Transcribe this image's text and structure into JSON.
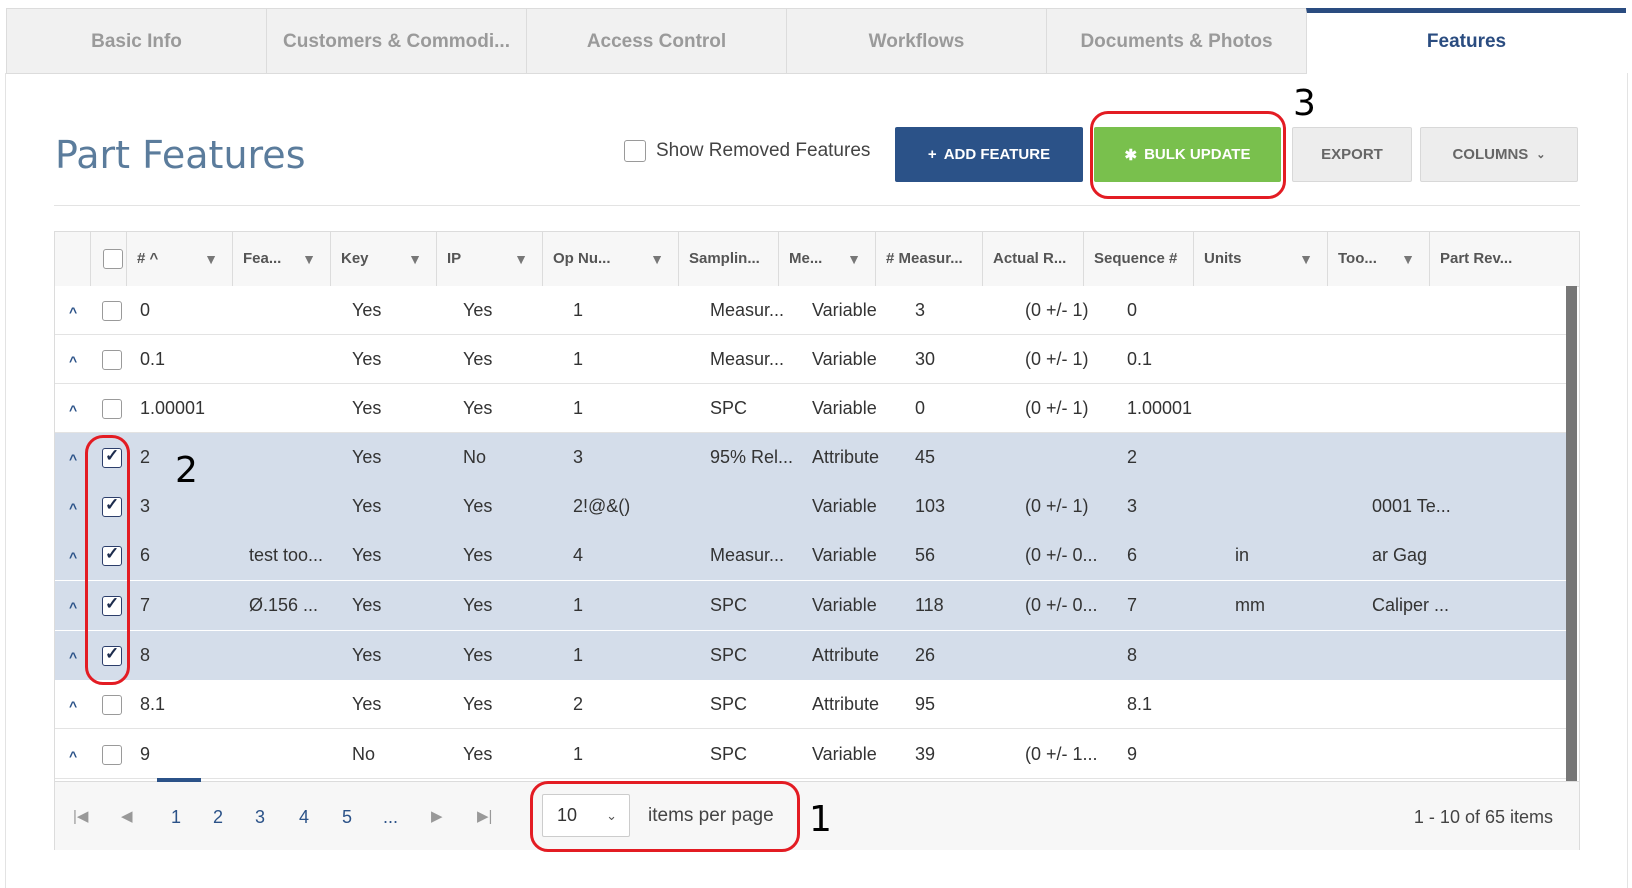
{
  "tabs": [
    {
      "label": "Basic Info",
      "active": false
    },
    {
      "label": "Customers & Commodi...",
      "active": false
    },
    {
      "label": "Access Control",
      "active": false
    },
    {
      "label": "Workflows",
      "active": false
    },
    {
      "label": "Documents & Photos",
      "active": false
    },
    {
      "label": "Features",
      "active": true
    }
  ],
  "header": {
    "title": "Part Features",
    "show_removed_label": "Show Removed Features",
    "add_feature_label": "ADD FEATURE",
    "bulk_update_label": "BULK UPDATE",
    "export_label": "EXPORT",
    "columns_label": "COLUMNS"
  },
  "grid": {
    "columns": [
      "#",
      "Fea...",
      "Key",
      "IP",
      "Op Nu...",
      "Samplin...",
      "Me...",
      "# Measur...",
      "Actual R...",
      "Sequence #",
      "Units",
      "Too...",
      "Part Rev..."
    ],
    "rows": [
      {
        "checked": false,
        "cells": [
          "0",
          "",
          "Yes",
          "Yes",
          "1",
          "Measur...",
          "Variable",
          "3",
          "(0 +/- 1)",
          "0",
          "",
          "",
          ""
        ]
      },
      {
        "checked": false,
        "cells": [
          "0.1",
          "",
          "Yes",
          "Yes",
          "1",
          "Measur...",
          "Variable",
          "30",
          "(0 +/- 1)",
          "0.1",
          "",
          "",
          ""
        ]
      },
      {
        "checked": false,
        "cells": [
          "1.00001",
          "",
          "Yes",
          "Yes",
          "1",
          "SPC",
          "Variable",
          "0",
          "(0 +/- 1)",
          "1.00001",
          "",
          "",
          ""
        ]
      },
      {
        "checked": true,
        "cells": [
          "2",
          "",
          "Yes",
          "No",
          "3",
          "95% Rel...",
          "Attribute",
          "45",
          "",
          "2",
          "",
          "",
          ""
        ]
      },
      {
        "checked": true,
        "cells": [
          "3",
          "",
          "Yes",
          "Yes",
          "2!@&()",
          "",
          "Variable",
          "103",
          "(0 +/- 1)",
          "3",
          "",
          "0001 Te...",
          ""
        ]
      },
      {
        "checked": true,
        "cells": [
          "6",
          "test too...",
          "Yes",
          "Yes",
          "4",
          "Measur...",
          "Variable",
          "56",
          "(0 +/- 0...",
          "6",
          "in",
          "ar Gag",
          ""
        ]
      },
      {
        "checked": true,
        "cells": [
          "7",
          "Ø.156 ...",
          "Yes",
          "Yes",
          "1",
          "SPC",
          "Variable",
          "118",
          "(0 +/- 0...",
          "7",
          "mm",
          "Caliper ...",
          ""
        ]
      },
      {
        "checked": true,
        "cells": [
          "8",
          "",
          "Yes",
          "Yes",
          "1",
          "SPC",
          "Attribute",
          "26",
          "",
          "8",
          "",
          "",
          ""
        ]
      },
      {
        "checked": false,
        "cells": [
          "8.1",
          "",
          "Yes",
          "Yes",
          "2",
          "SPC",
          "Attribute",
          "95",
          "",
          "8.1",
          "",
          "",
          ""
        ]
      },
      {
        "checked": false,
        "cells": [
          "9",
          "",
          "No",
          "Yes",
          "1",
          "SPC",
          "Variable",
          "39",
          "(0 +/- 1...",
          "9",
          "",
          "",
          ""
        ]
      }
    ]
  },
  "pager": {
    "pages": [
      "1",
      "2",
      "3",
      "4",
      "5",
      "..."
    ],
    "current_page": "1",
    "page_size": "10",
    "page_size_label": "items per page",
    "summary": "1 - 10 of 65 items"
  },
  "annotations": {
    "callout_1": "1",
    "callout_2": "2",
    "callout_3": "3"
  },
  "colors": {
    "accent": "#2b5288",
    "bulk_green": "#79c04d",
    "selected_row": "#d4ddea",
    "callout_red": "#e31c23"
  }
}
